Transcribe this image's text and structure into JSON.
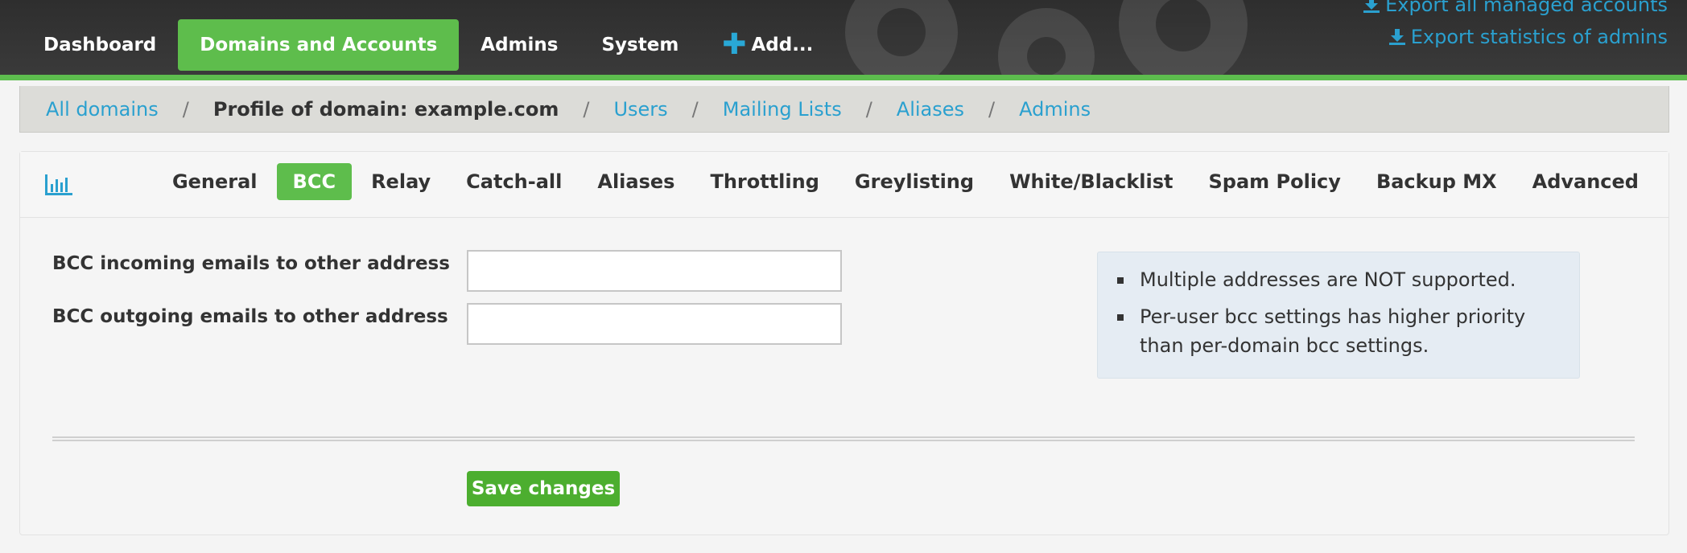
{
  "nav": {
    "items": [
      {
        "label": "Dashboard"
      },
      {
        "label": "Domains and Accounts"
      },
      {
        "label": "Admins"
      },
      {
        "label": "System"
      },
      {
        "label": "Add..."
      }
    ]
  },
  "export": {
    "managed_accounts": "Export all managed accounts",
    "admin_statistics": "Export statistics of admins"
  },
  "breadcrumb": {
    "all_domains": "All domains",
    "profile": "Profile of domain: example.com",
    "users": "Users",
    "mailing_lists": "Mailing Lists",
    "aliases": "Aliases",
    "admins": "Admins",
    "separator": "/"
  },
  "tabs": [
    {
      "label": "General"
    },
    {
      "label": "BCC"
    },
    {
      "label": "Relay"
    },
    {
      "label": "Catch-all"
    },
    {
      "label": "Aliases"
    },
    {
      "label": "Throttling"
    },
    {
      "label": "Greylisting"
    },
    {
      "label": "White/Blacklist"
    },
    {
      "label": "Spam Policy"
    },
    {
      "label": "Backup MX"
    },
    {
      "label": "Advanced"
    }
  ],
  "form": {
    "bcc_incoming_label": "BCC incoming emails to other address",
    "bcc_incoming_value": "",
    "bcc_outgoing_label": "BCC outgoing emails to other address",
    "bcc_outgoing_value": "",
    "save_label": "Save changes"
  },
  "notes": [
    "Multiple addresses are NOT supported.",
    "Per-user bcc settings has higher priority than per-domain bcc settings."
  ],
  "colors": {
    "accent_green": "#5ebd4c",
    "link_blue": "#2aa0cf",
    "topbar": "#333333"
  },
  "icons": [
    "plus-icon",
    "download-icon",
    "chart-icon"
  ]
}
